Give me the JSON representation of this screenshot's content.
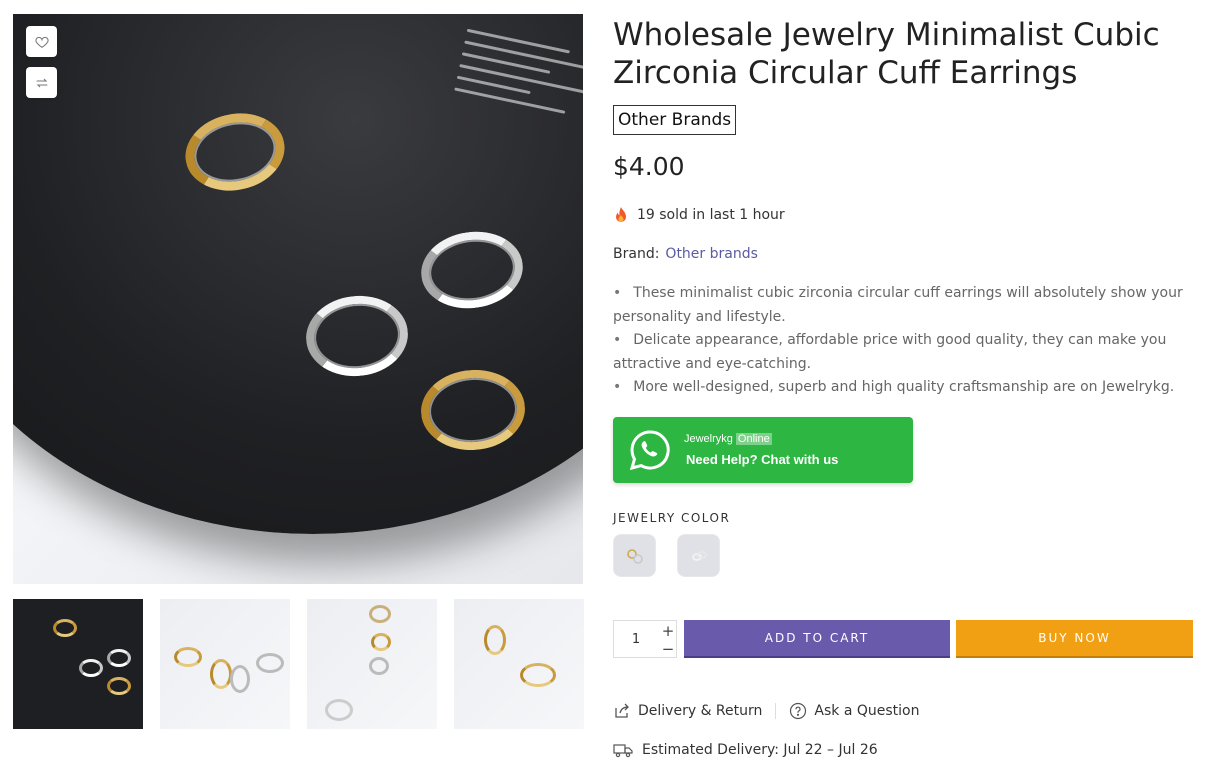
{
  "product": {
    "title": "Wholesale Jewelry Minimalist Cubic Zirconia Circular Cuff Earrings",
    "brand_badge": "Other Brands",
    "price": "$4.00",
    "sold_text": "19 sold in last 1 hour",
    "brand_label": "Brand:",
    "brand_link": "Other brands",
    "description": [
      "These minimalist cubic zirconia circular cuff earrings will absolutely show your personality and lifestyle.",
      "Delicate appearance, affordable price with good quality, they can make you attractive and eye-catching.",
      "More well-designed, superb and high quality craftsmanship are on Jewelrykg."
    ]
  },
  "gallery": {
    "wishlist_icon": "heart-icon",
    "compare_icon": "compare-icon",
    "thumbnails": [
      "thumbnail-1",
      "thumbnail-2",
      "thumbnail-3",
      "thumbnail-4"
    ]
  },
  "chat": {
    "agent": "Jewelrykg",
    "status": "Online",
    "cta": "Need Help? Chat with us",
    "color": "#2db642"
  },
  "options": {
    "color_label": "JEWELRY COLOR",
    "swatches": [
      "gold",
      "silver"
    ]
  },
  "cart": {
    "quantity": "1",
    "plus": "+",
    "minus": "−",
    "add_to_cart": "ADD TO CART",
    "buy_now": "BUY NOW",
    "add_color": "#6a5aab",
    "buy_color": "#f1a013"
  },
  "footer_links": {
    "delivery_return": "Delivery & Return",
    "ask_question": "Ask a Question",
    "estimated_delivery": "Estimated Delivery: Jul 22 – Jul 26"
  }
}
